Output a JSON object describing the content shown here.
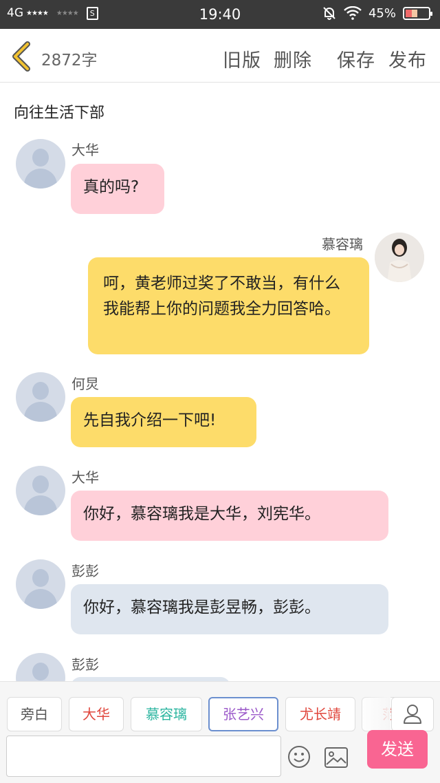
{
  "status_bar": {
    "network": "4G",
    "signal1": "★★★★",
    "signal2": "★★★★",
    "sim_icon_label": "S",
    "time": "19:40",
    "battery": "45%"
  },
  "header": {
    "word_count": "2872字",
    "actions": {
      "old_version": "旧版",
      "delete": "删除",
      "save": "保存",
      "publish": "发布"
    }
  },
  "document": {
    "title": "向往生活下部"
  },
  "messages": [
    {
      "speaker": "大华",
      "text": "真的吗?",
      "color": "#ffd0d9"
    },
    {
      "speaker": "慕容璃",
      "text": "呵，黄老师过奖了不敢当，有什么我能帮上你的问题我全力回答哈。",
      "color": "#fddc6a"
    },
    {
      "speaker": "何炅",
      "text": "先自我介绍一下吧!",
      "color": "#fddc6a"
    },
    {
      "speaker": "大华",
      "text": "你好，慕容璃我是大华，刘宪华。",
      "color": "#ffd0d9"
    },
    {
      "speaker": "彭彭",
      "text": "你好，慕容璃我是彭昱畅，彭彭。",
      "color": "#dfe6ef"
    },
    {
      "speaker": "彭彭",
      "text": ""
    }
  ],
  "roles": [
    {
      "label": "旁白",
      "color": "#555555"
    },
    {
      "label": "大华",
      "color": "#e0463c"
    },
    {
      "label": "慕容璃",
      "color": "#2bb5a0"
    },
    {
      "label": "张艺兴",
      "color": "#9b59c9",
      "selected": true
    },
    {
      "label": "尤长靖",
      "color": "#e0463c"
    },
    {
      "label": "范",
      "color": "#e0463c"
    }
  ],
  "composer": {
    "input_value": "",
    "send_label": "发送",
    "icons": [
      "emoji-icon",
      "image-icon",
      "person-icon"
    ]
  }
}
